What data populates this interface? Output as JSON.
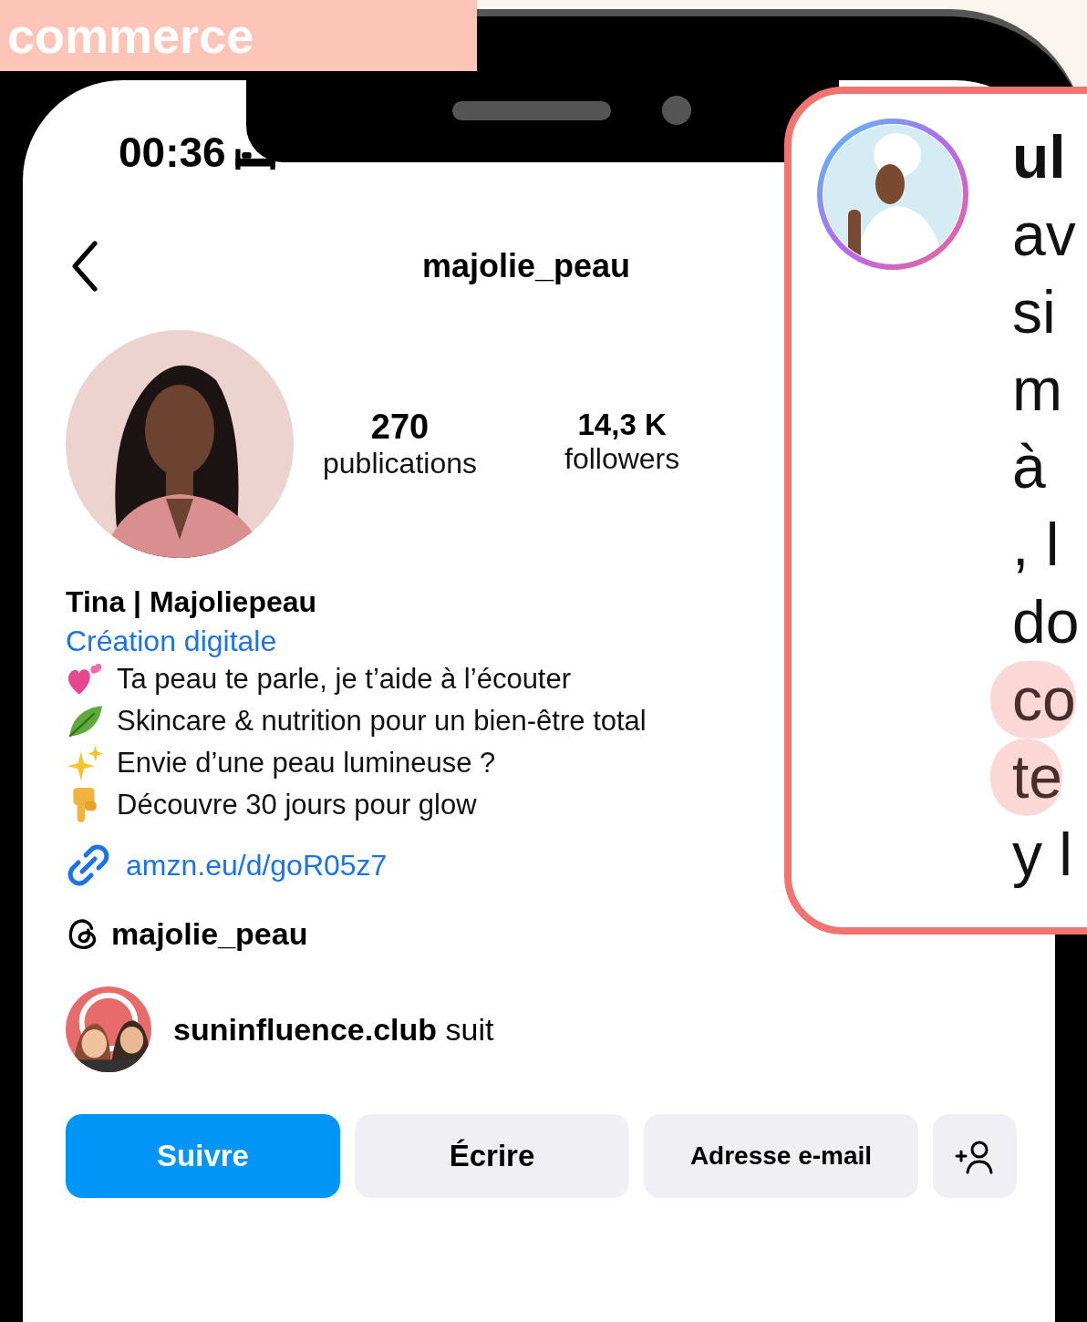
{
  "banner": {
    "title": "commerce"
  },
  "status_bar": {
    "time": "00:36"
  },
  "header": {
    "username": "majolie_peau"
  },
  "stats": [
    {
      "value": "270",
      "label": "publications"
    },
    {
      "value": "14,3 K",
      "label": "followers"
    }
  ],
  "profile": {
    "name": "Tina | Majoliepeau",
    "category": "Création digitale",
    "bio": [
      {
        "kind": "hearts",
        "text": "Ta peau te parle, je t’aide à l’écouter"
      },
      {
        "kind": "leaf",
        "text": "Skincare & nutrition pour un bien-être total"
      },
      {
        "kind": "sparkles",
        "text": "Envie d’une peau lumineuse ?"
      },
      {
        "kind": "pointing",
        "text": "Découvre 30 jours pour glow"
      }
    ],
    "link": "amzn.eu/d/goR05z7",
    "threads": "majolie_peau",
    "followed_by": {
      "name": "suninfluence.club",
      "suffix": "suit"
    }
  },
  "buttons": [
    {
      "kind": "primary",
      "label": "Suivre"
    },
    {
      "kind": "secondary",
      "label": "Écrire"
    },
    {
      "kind": "secondary",
      "label": "Adresse e-mail"
    },
    {
      "kind": "add-person"
    }
  ],
  "overlay_card": {
    "lines": [
      {
        "text": "ul",
        "bold": true,
        "highlighted": false
      },
      {
        "text": "av",
        "bold": false,
        "highlighted": false
      },
      {
        "text": "si",
        "bold": false,
        "highlighted": false
      },
      {
        "text": "m",
        "bold": false,
        "highlighted": false
      },
      {
        "text": "à",
        "bold": false,
        "highlighted": false
      },
      {
        "text": ", l",
        "bold": false,
        "highlighted": false
      },
      {
        "text": "do",
        "bold": false,
        "highlighted": false
      },
      {
        "text": "co",
        "bold": false,
        "highlighted": true
      },
      {
        "text": "te",
        "bold": false,
        "highlighted": true
      },
      {
        "text": "y l",
        "bold": false,
        "highlighted": false
      }
    ]
  }
}
